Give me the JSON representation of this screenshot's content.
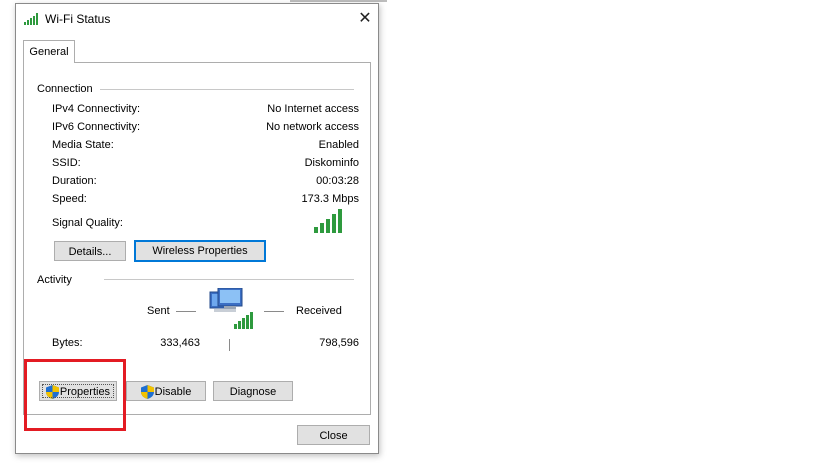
{
  "window": {
    "title": "Wi-Fi Status"
  },
  "tabs": [
    {
      "label": "General"
    }
  ],
  "connection": {
    "group_label": "Connection",
    "rows": [
      {
        "label": "IPv4 Connectivity:",
        "value": "No Internet access"
      },
      {
        "label": "IPv6 Connectivity:",
        "value": "No network access"
      },
      {
        "label": "Media State:",
        "value": "Enabled"
      },
      {
        "label": "SSID:",
        "value": "Diskominfo"
      },
      {
        "label": "Duration:",
        "value": "00:03:28"
      },
      {
        "label": "Speed:",
        "value": "173.3 Mbps"
      }
    ],
    "signal_label": "Signal Quality:",
    "signal_bars": 5,
    "details_button": "Details...",
    "wireless_properties_button": "Wireless Properties"
  },
  "activity": {
    "group_label": "Activity",
    "sent_label": "Sent",
    "received_label": "Received",
    "bytes_label": "Bytes:",
    "bytes_sent": "333,463",
    "bytes_received": "798,596"
  },
  "actions": {
    "properties": "Properties",
    "disable": "Disable",
    "diagnose": "Diagnose"
  },
  "footer": {
    "close": "Close"
  },
  "colors": {
    "signal_green": "#2e9a3e",
    "focus_blue": "#0078d7",
    "highlight_red": "#e31b23"
  }
}
